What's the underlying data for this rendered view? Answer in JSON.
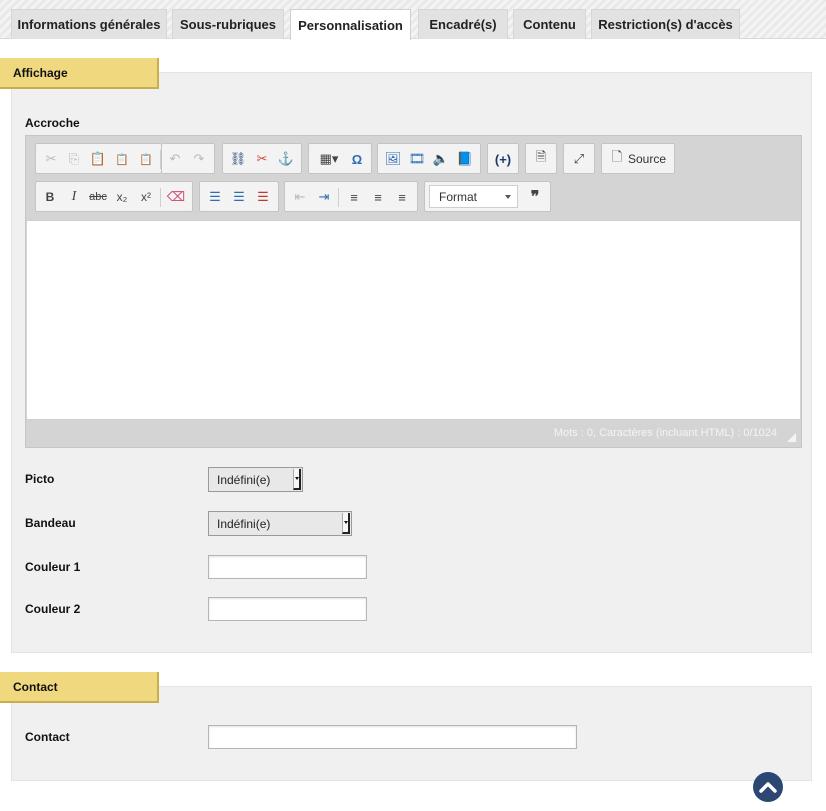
{
  "tabs": [
    {
      "label": "Informations générales",
      "active": false
    },
    {
      "label": "Sous-rubriques",
      "active": false
    },
    {
      "label": "Personnalisation",
      "active": true
    },
    {
      "label": "Encadré(s)",
      "active": false
    },
    {
      "label": "Contenu",
      "active": false
    },
    {
      "label": "Restriction(s) d'accès",
      "active": false
    }
  ],
  "affichage": {
    "title": "Affichage",
    "accroche_label": "Accroche",
    "editor": {
      "source_label": "Source",
      "format_label": "Format",
      "status": "Mots : 0, Caractères (incluant HTML) : 0/1024",
      "toolbar_icons": [
        "cut-icon",
        "copy-icon",
        "paste-icon",
        "paste-text-icon",
        "paste-word-icon",
        "undo-icon",
        "redo-icon",
        "link-icon",
        "unlink-icon",
        "anchor-icon",
        "table-icon",
        "special-char-icon",
        "image-icon",
        "video-icon",
        "audio-icon",
        "book-icon",
        "placeholder-icon",
        "preview-icon",
        "maximize-icon",
        "bold-icon",
        "italic-icon",
        "strike-icon",
        "subscript-icon",
        "superscript-icon",
        "remove-format-icon",
        "numbered-list-icon",
        "bulleted-list-icon",
        "remove-list-icon",
        "outdent-icon",
        "indent-icon",
        "align-left-icon",
        "align-center-icon",
        "align-right-icon",
        "blockquote-icon"
      ]
    },
    "picto_label": "Picto",
    "picto_value": "Indéfini(e)",
    "bandeau_label": "Bandeau",
    "bandeau_value": "Indéfini(e)",
    "couleur1_label": "Couleur 1",
    "couleur1_value": "",
    "couleur2_label": "Couleur 2",
    "couleur2_value": ""
  },
  "contact": {
    "title": "Contact",
    "contact_label": "Contact",
    "contact_value": ""
  },
  "colors": {
    "section_title_bg": "#f0d87e",
    "scroll_top_bg": "#2d4773"
  }
}
